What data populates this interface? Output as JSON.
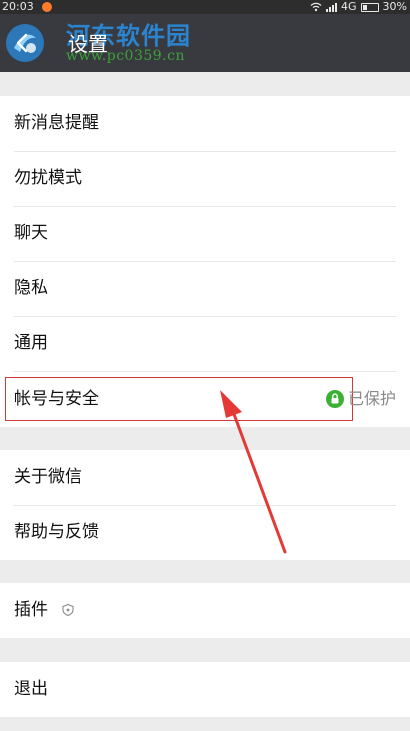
{
  "status_bar": {
    "time": "20:03",
    "network": "4G",
    "battery": "30%"
  },
  "header": {
    "title": "设置",
    "back_icon": "back-arrow-icon"
  },
  "watermark": {
    "name": "河东软件园",
    "url": "www.pc0359.cn"
  },
  "groups": [
    {
      "items": [
        {
          "label": "新消息提醒"
        },
        {
          "label": "勿扰模式"
        },
        {
          "label": "聊天"
        },
        {
          "label": "隐私"
        },
        {
          "label": "通用"
        },
        {
          "label": "帐号与安全",
          "status": "已保护",
          "status_icon": "lock-icon",
          "highlighted": true
        }
      ]
    },
    {
      "items": [
        {
          "label": "关于微信"
        },
        {
          "label": "帮助与反馈"
        }
      ]
    },
    {
      "items": [
        {
          "label": "插件",
          "icon": "shield-icon"
        }
      ]
    },
    {
      "items": [
        {
          "label": "退出"
        }
      ]
    }
  ],
  "colors": {
    "header_bg": "#393a3f",
    "highlight_border": "#d23a3a",
    "lock_green": "#3cb034",
    "watermark_blue": "#2a84cf",
    "watermark_green": "#3da03a"
  }
}
